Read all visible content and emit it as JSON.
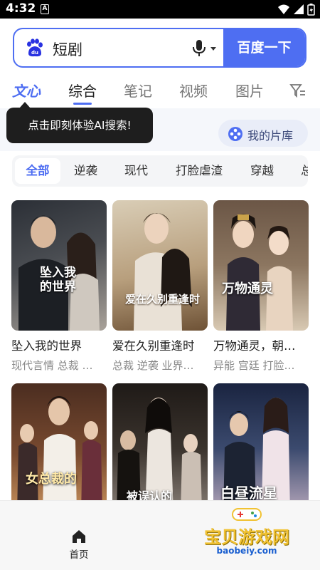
{
  "status_bar": {
    "time": "4:32",
    "notification_badge": "A"
  },
  "search": {
    "query": "短剧",
    "button_label": "百度一下",
    "brand_color": "#4e6ef2"
  },
  "tabs": [
    {
      "label": "文心",
      "active": false
    },
    {
      "label": "综合",
      "active": true
    },
    {
      "label": "笔记",
      "active": false
    },
    {
      "label": "视频",
      "active": false
    },
    {
      "label": "图片",
      "active": false
    }
  ],
  "tooltip": {
    "text": "点击即刻体验AI搜索!"
  },
  "my_library": {
    "label": "我的片库"
  },
  "categories": [
    "全部",
    "逆袭",
    "现代",
    "打脸虐渣",
    "穿越",
    "总"
  ],
  "dramas": [
    {
      "title": "坠入我的世界",
      "tags": "现代言情 总裁 …",
      "poster_text": "坠入我的世界",
      "colors": [
        "#3a3f45",
        "#b9b2a8"
      ]
    },
    {
      "title": "爱在久别重逢时",
      "tags": "总裁 逆袭 业界…",
      "poster_text": "爱在久别重逢时",
      "colors": [
        "#c9b89a",
        "#7a5c3d"
      ]
    },
    {
      "title": "万物通灵，朝…",
      "tags": "异能 宫廷 打脸…",
      "poster_text": "万物通灵",
      "colors": [
        "#5c4a3a",
        "#d8c7b0"
      ]
    },
    {
      "title": "",
      "tags": "",
      "poster_text": "女总裁的",
      "colors": [
        "#5a3a2a",
        "#c29060"
      ]
    },
    {
      "title": "",
      "tags": "",
      "poster_text": "被误认的",
      "colors": [
        "#2a2420",
        "#d8cfc6"
      ]
    },
    {
      "title": "",
      "tags": "",
      "poster_text": "白昼流星",
      "colors": [
        "#1d2a48",
        "#c7b8c8"
      ]
    }
  ],
  "bottom_nav": {
    "home_label": "首页"
  },
  "watermark": {
    "text": "宝贝游戏网",
    "url": "baobeiy.com"
  }
}
